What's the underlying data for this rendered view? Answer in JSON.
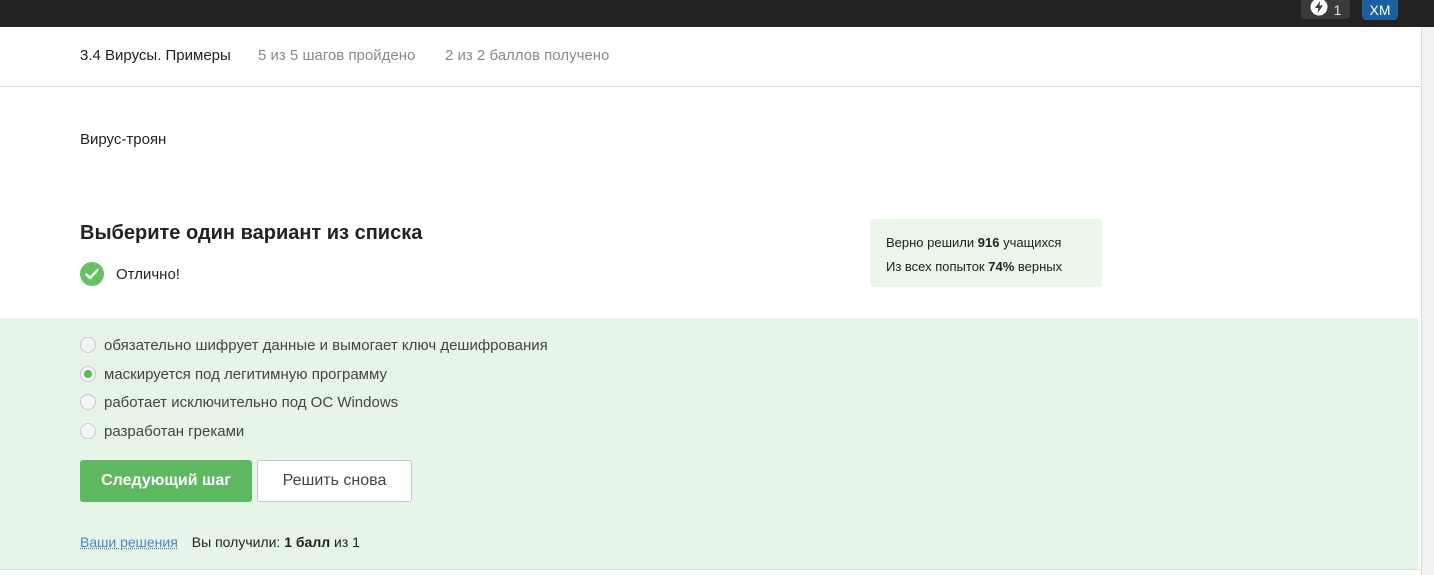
{
  "topbar": {
    "notifications_count": "1",
    "avatar_initials": "ХМ"
  },
  "lesson": {
    "title": "3.4 Вирусы. Примеры",
    "steps_progress": "5 из 5 шагов пройдено",
    "score_progress": "2 из 2 баллов  получено"
  },
  "step": {
    "text": "Вирус-троян"
  },
  "quiz": {
    "heading": "Выберите один вариант из списка",
    "result_text": "Отлично!",
    "stats": {
      "solved_prefix": "Верно решили",
      "solved_count": "916",
      "solved_suffix": "учащихся",
      "attempts_prefix": "Из всех попыток",
      "attempts_percent": "74%",
      "attempts_suffix": "верных"
    },
    "options": [
      {
        "label": "обязательно шифрует данные и вымогает ключ дешифрования",
        "checked": false
      },
      {
        "label": "маскируется под легитимную программу",
        "checked": true
      },
      {
        "label": "работает исключительно под ОС Windows",
        "checked": false
      },
      {
        "label": "разработан греками",
        "checked": false
      }
    ],
    "next_button": "Следующий шаг",
    "retry_button": "Решить снова",
    "solutions_link": "Ваши решения",
    "got_prefix": "Вы получили:",
    "got_points": "1 балл",
    "got_suffix": "из 1"
  },
  "colors": {
    "accent_green": "#5db860",
    "quiz_background": "#e7f5e8",
    "topbar": "#222222",
    "avatar": "#1e5f9e",
    "link": "#4a86c6"
  }
}
